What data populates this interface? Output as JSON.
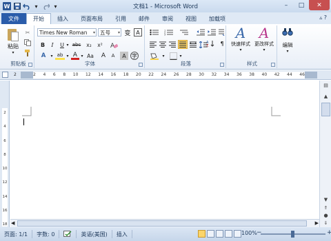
{
  "window": {
    "title": "文档1 - Microsoft Word",
    "app_logo": "W"
  },
  "qat": {
    "save_icon": "save-icon",
    "undo_icon": "undo-icon",
    "redo_icon": "redo-icon"
  },
  "tabs": {
    "file": "文件",
    "items": [
      "开始",
      "插入",
      "页面布局",
      "引用",
      "邮件",
      "审阅",
      "视图",
      "加载项"
    ],
    "active_index": 0
  },
  "clipboard": {
    "paste_label": "粘贴",
    "group_label": "剪贴板"
  },
  "font": {
    "font_name": "Times New Roman",
    "font_size": "五号",
    "group_label": "字体",
    "bold": "B",
    "italic": "I",
    "underline": "U",
    "strike": "abc",
    "subscript": "x₂",
    "superscript": "x²",
    "grow": "A",
    "shrink": "A",
    "color_a": "A",
    "highlight": "ab",
    "aa": "Aa",
    "phonetic": "变",
    "border_a": "A",
    "char_shade": "A",
    "enclose": "字"
  },
  "paragraph": {
    "group_label": "段落"
  },
  "styles": {
    "quick_label": "快速样式",
    "change_label": "更改样式",
    "group_label": "样式"
  },
  "editing": {
    "label": "编辑"
  },
  "ruler": {
    "ticks": [
      "2",
      "2",
      "4",
      "6",
      "8",
      "10",
      "12",
      "14",
      "16",
      "18",
      "20",
      "22",
      "24",
      "26",
      "28",
      "30",
      "32",
      "34",
      "36",
      "38",
      "40",
      "42",
      "44",
      "46"
    ]
  },
  "vruler": {
    "ticks": [
      "2",
      "4",
      "6",
      "8",
      "10",
      "12",
      "14",
      "16",
      "18"
    ]
  },
  "status": {
    "page": "页面: 1/1",
    "words": "字数: 0",
    "language": "英语(美国)",
    "mode": "插入",
    "zoom": "100%"
  },
  "colors": {
    "accent": "#2a5caa",
    "ribbon_bg": "#e8eef7",
    "highlight_yellow": "#fbd56b",
    "font_red": "#d12020"
  }
}
